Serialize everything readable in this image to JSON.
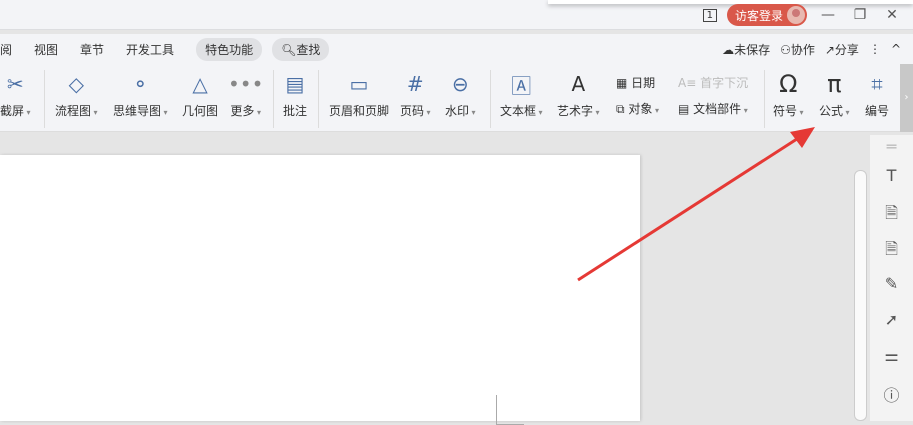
{
  "titlebar": {
    "page_indicator": "1",
    "login": "访客登录",
    "minimize": "—",
    "restore": "❐",
    "close": "✕"
  },
  "tabs": [
    "审阅",
    "视图",
    "章节",
    "开发工具",
    "特色功能"
  ],
  "search": "查找",
  "actions": {
    "unsaved": "未保存",
    "collab": "协作",
    "share": "分享",
    "more": "⋮",
    "collapse": "^"
  },
  "tools": {
    "screenshot": "截屏",
    "flowchart": "流程图",
    "mindmap": "思维导图",
    "geometry": "几何图",
    "more": "更多",
    "comment": "批注",
    "header_footer": "页眉和页脚",
    "page_num": "页码",
    "watermark": "水印",
    "textbox": "文本框",
    "wordart": "艺术字",
    "date": "日期",
    "dropcap": "首字下沉",
    "object": "对象",
    "docpart": "文档部件",
    "symbol": "符号",
    "formula": "公式",
    "numbering": "编号"
  },
  "colors": {
    "accent": "#d9584a",
    "arrow": "#e53935"
  }
}
